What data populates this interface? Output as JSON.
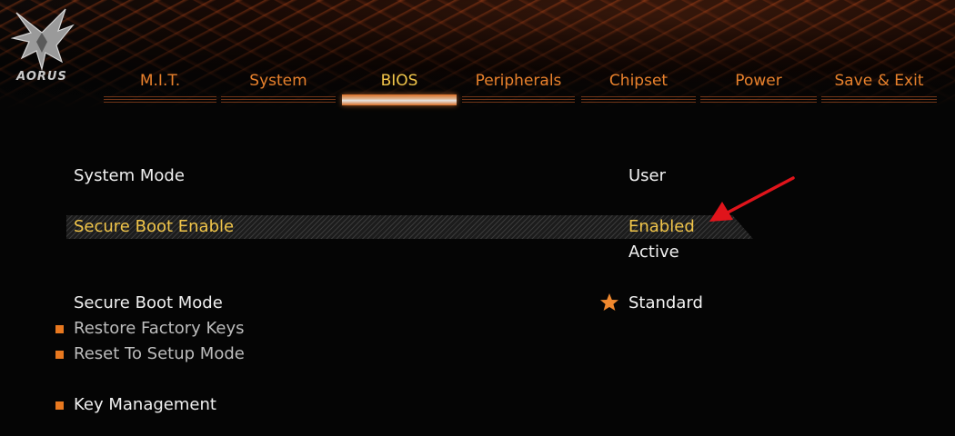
{
  "brand": {
    "logo_text": "AORUS"
  },
  "tabs": [
    {
      "label": "M.I.T.",
      "active": false
    },
    {
      "label": "System",
      "active": false
    },
    {
      "label": "BIOS",
      "active": true
    },
    {
      "label": "Peripherals",
      "active": false
    },
    {
      "label": "Chipset",
      "active": false
    },
    {
      "label": "Power",
      "active": false
    },
    {
      "label": "Save & Exit",
      "active": false
    }
  ],
  "settings": {
    "system_mode": {
      "label": "System Mode",
      "value": "User"
    },
    "secure_boot_enable": {
      "label": "Secure Boot Enable",
      "value": "Enabled",
      "status": "Active",
      "selected": true
    },
    "secure_boot_mode": {
      "label": "Secure Boot Mode",
      "value": "Standard"
    },
    "submenus": [
      {
        "label": "Restore Factory Keys"
      },
      {
        "label": "Reset To Setup Mode"
      },
      {
        "label": "Key Management"
      }
    ]
  },
  "icons": {
    "submenu_bullet": "square-bullet-icon",
    "default_marker": "star-icon",
    "annotation": "red-arrow-icon"
  },
  "colors": {
    "tab_text": "#e8812c",
    "tab_active_text": "#f2c64a",
    "selected_text": "#f2c64a",
    "bullet": "#e8781f",
    "arrow": "#e0141b"
  }
}
